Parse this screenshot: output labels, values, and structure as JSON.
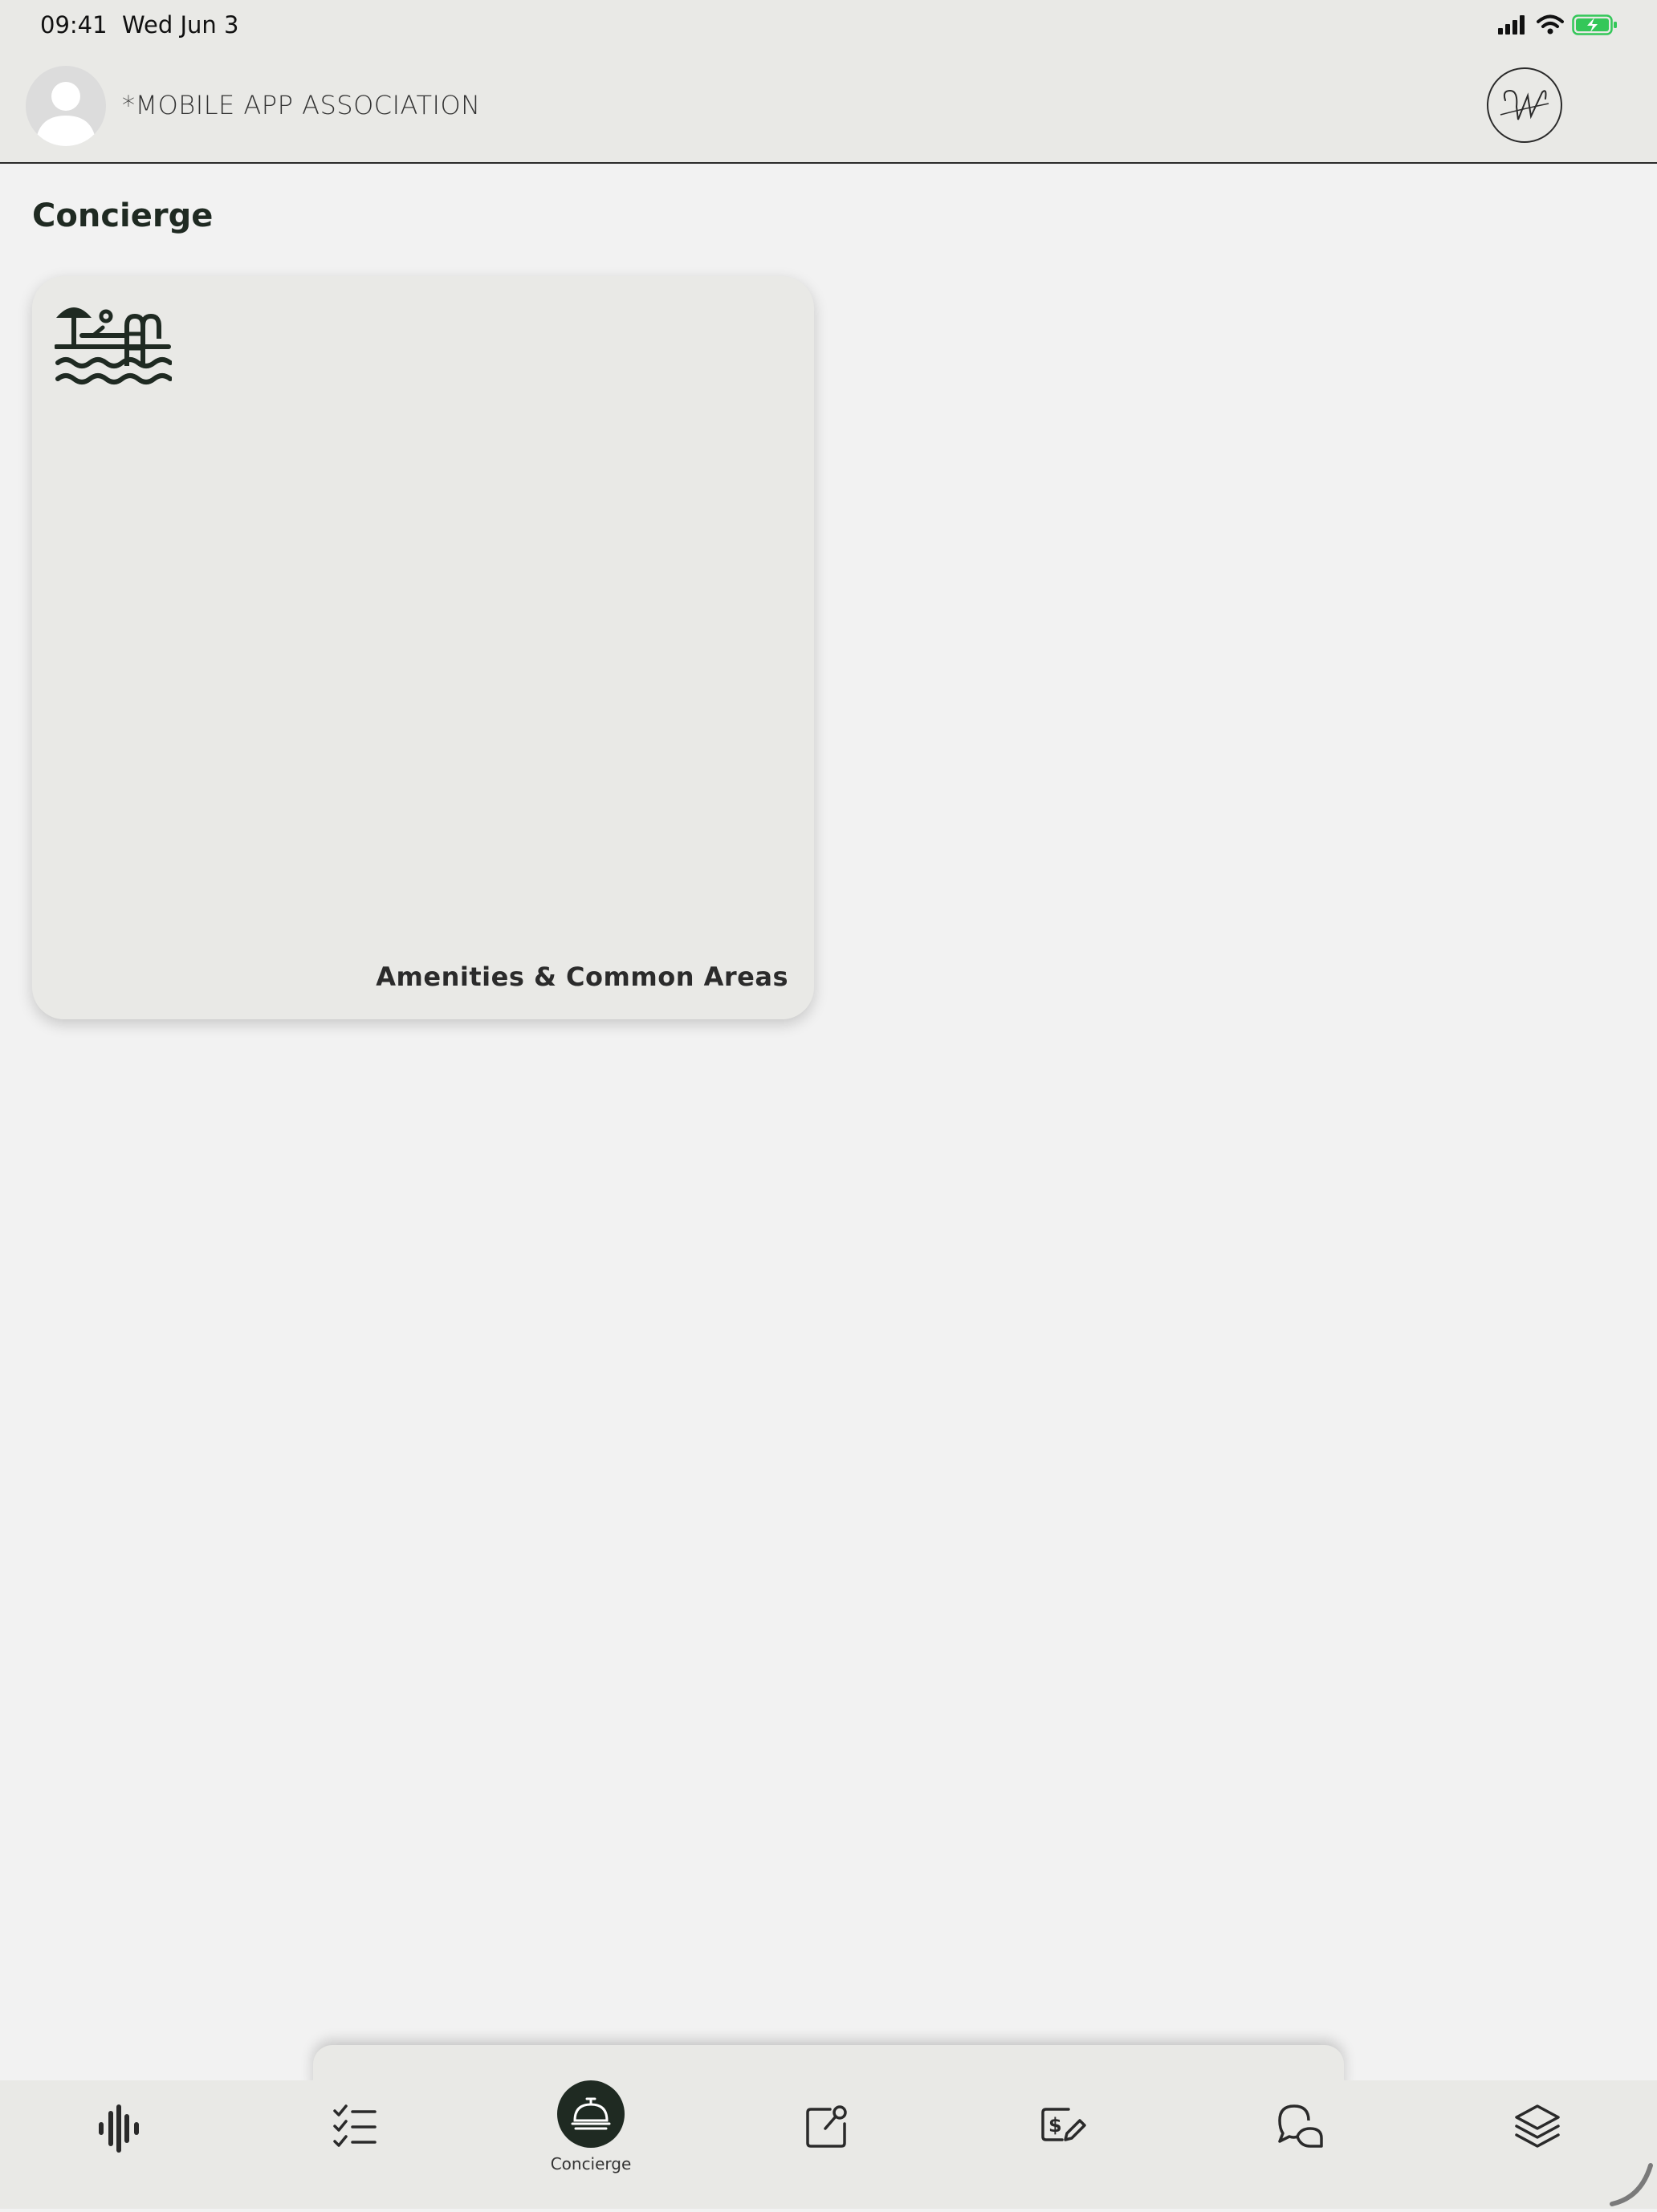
{
  "status_bar": {
    "time": "09:41",
    "date": "Wed Jun 3",
    "icons": [
      "cellular-signal-icon",
      "wifi-icon",
      "battery-charging-icon"
    ],
    "battery_color": "#34c759"
  },
  "header": {
    "association_name": "*MOBILE APP ASSOCIATION",
    "avatar_icon": "user-avatar-icon",
    "logo_icon": "association-logo-icon"
  },
  "page": {
    "title": "Concierge",
    "cards": [
      {
        "label": "Amenities & Common Areas",
        "icon": "pool-amenities-icon"
      }
    ]
  },
  "tab_bar": {
    "active": "Concierge",
    "tabs": [
      {
        "icon": "audio-wave-icon"
      },
      {
        "icon": "checklist-icon"
      },
      {
        "icon": "concierge-bell-icon",
        "label": "Concierge"
      },
      {
        "icon": "edit-square-icon"
      },
      {
        "icon": "payment-edit-icon"
      },
      {
        "icon": "chat-bubbles-icon"
      },
      {
        "icon": "layers-icon"
      }
    ]
  },
  "colors": {
    "header_bg": "#e9e9e6",
    "page_bg": "#f2f2f2",
    "accent_dark": "#1f2a22"
  }
}
